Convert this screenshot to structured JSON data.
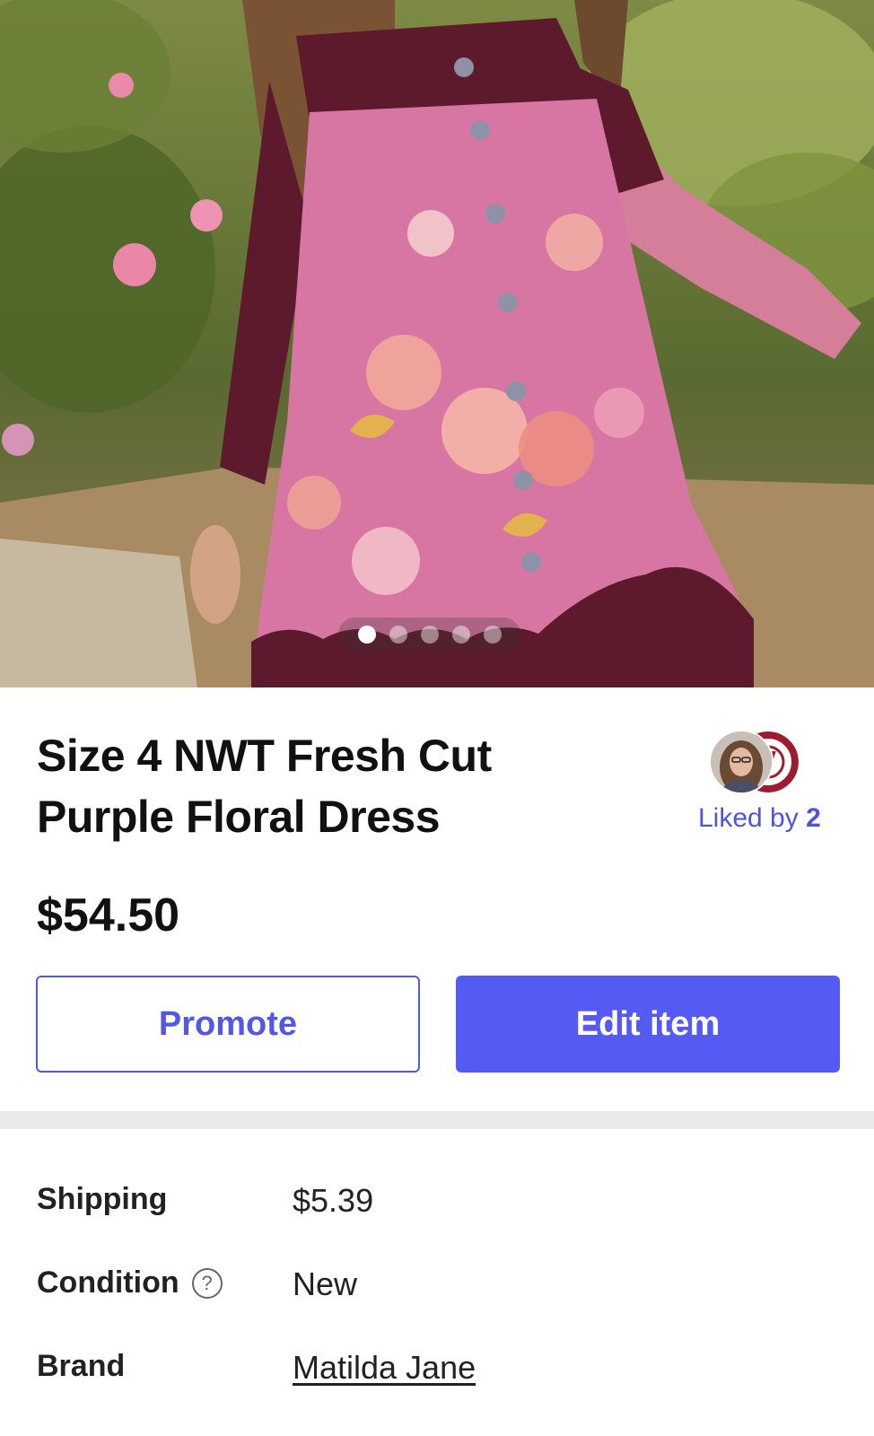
{
  "listing": {
    "title": "Size 4 NWT Fresh Cut Purple Floral Dress",
    "price": "$54.50"
  },
  "carousel": {
    "photo_count": 5,
    "active_index": 0
  },
  "likes": {
    "label": "Liked by",
    "count": "2"
  },
  "actions": {
    "promote_label": "Promote",
    "edit_label": "Edit item"
  },
  "details": {
    "shipping_label": "Shipping",
    "shipping_value": "$5.39",
    "condition_label": "Condition",
    "condition_value": "New",
    "brand_label": "Brand",
    "brand_value": "Matilda Jane"
  },
  "help_icon_glyph": "?",
  "colors": {
    "accent": "#555af2",
    "link_purple": "#4e56d8",
    "separator": "#e9e9eb"
  }
}
